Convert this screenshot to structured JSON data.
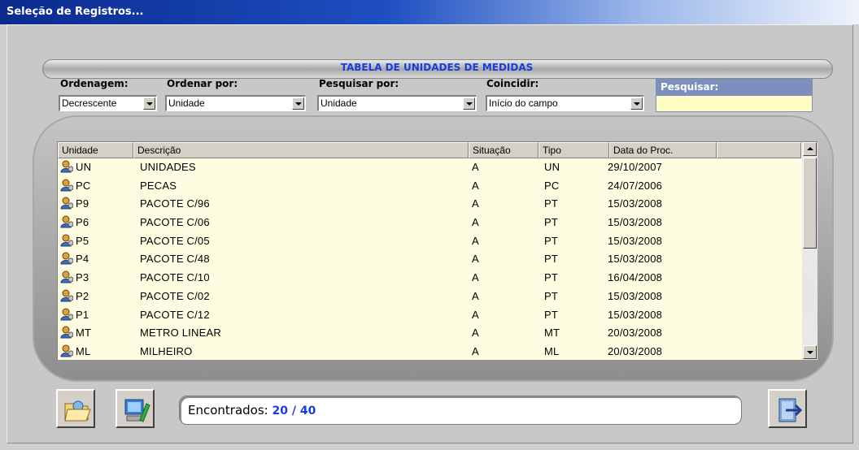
{
  "window": {
    "title": "Seleção de Registros..."
  },
  "table_title": "TABELA DE UNIDADES DE MEDIDAS",
  "filters": {
    "ordenagem": {
      "label": "Ordenagem:",
      "value": "Decrescente"
    },
    "ordenar_por": {
      "label": "Ordenar por:",
      "value": "Unidade"
    },
    "pesquisar_por": {
      "label": "Pesquisar por:",
      "value": "Unidade"
    },
    "coincidir": {
      "label": "Coincidir:",
      "value": "Início do campo"
    },
    "pesquisar": {
      "label": "Pesquisar:",
      "value": ""
    }
  },
  "grid": {
    "columns": [
      "Unidade",
      "Descrição",
      "Situação",
      "Tipo",
      "Data do Proc."
    ],
    "rows": [
      [
        "UN",
        "UNIDADES",
        "A",
        "UN",
        "29/10/2007"
      ],
      [
        "PC",
        "PECAS",
        "A",
        "PC",
        "24/07/2006"
      ],
      [
        "P9",
        "PACOTE C/96",
        "A",
        "PT",
        "15/03/2008"
      ],
      [
        "P6",
        "PACOTE C/06",
        "A",
        "PT",
        "15/03/2008"
      ],
      [
        "P5",
        "PACOTE C/05",
        "A",
        "PT",
        "15/03/2008"
      ],
      [
        "P4",
        "PACOTE C/48",
        "A",
        "PT",
        "15/03/2008"
      ],
      [
        "P3",
        "PACOTE C/10",
        "A",
        "PT",
        "16/04/2008"
      ],
      [
        "P2",
        "PACOTE C/02",
        "A",
        "PT",
        "15/03/2008"
      ],
      [
        "P1",
        "PACOTE C/12",
        "A",
        "PT",
        "15/03/2008"
      ],
      [
        "MT",
        "METRO LINEAR",
        "A",
        "MT",
        "20/03/2008"
      ],
      [
        "ML",
        "MILHEIRO",
        "A",
        "ML",
        "20/03/2008"
      ]
    ],
    "row_icon": "user-record-icon"
  },
  "status": {
    "label": "Encontrados:",
    "count": "20 / 40"
  },
  "buttons": {
    "open": {
      "icon": "open-folder-icon"
    },
    "edit": {
      "icon": "computer-edit-icon"
    },
    "exit": {
      "icon": "exit-door-icon"
    }
  },
  "colors": {
    "title_bar": "#0a2a8e",
    "accent_blue": "#1a3cdc",
    "grid_bg": "#fffde1",
    "search_bg": "#fffdc4",
    "search_label_bg": "#7c8fbd"
  }
}
